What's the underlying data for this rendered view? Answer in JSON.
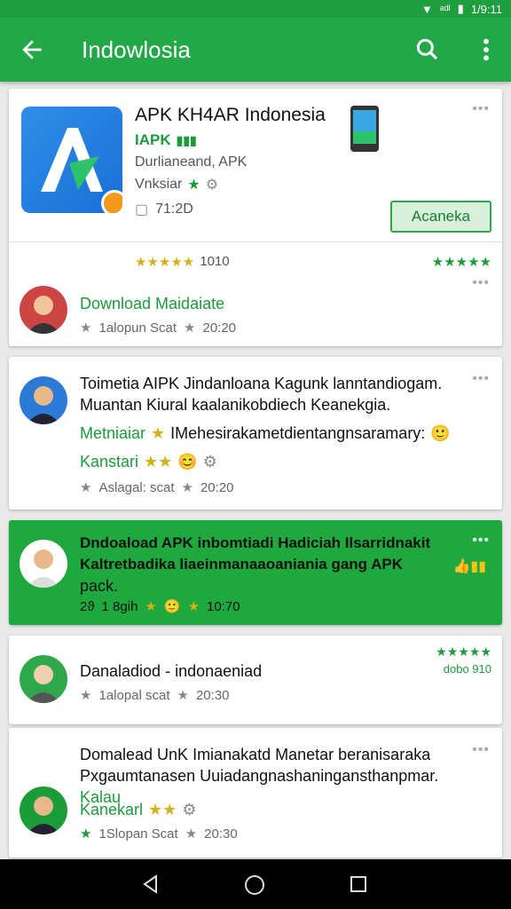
{
  "status_bar": {
    "time": "1/9:11",
    "signal_text": "ᵃᵈˡ"
  },
  "app_bar": {
    "title": "Indowlosia"
  },
  "app_card": {
    "name": "APK KH4AR  Indonesia",
    "sub_label": "IAPK",
    "description": "Durlianeand, APK",
    "rating_label": "Vnksiar",
    "size": "71:2D",
    "install_label": "Acaneka",
    "stars_left": "★★★★★",
    "stars_count": "1010",
    "stars_right": "★★★★★",
    "menu": "•••"
  },
  "reviews": [
    {
      "title": "Download Maidaiate",
      "meta_left": "1alopun Scat",
      "meta_right": "20:20",
      "menu": "•••"
    },
    {
      "body": "Toimetia AIPK Jindanloana Kagunk lanntandiogam. Muantan Kiural kaalanikobdiech Keanekgia.",
      "tag": "Metniaiar",
      "tag_rest": "IMehesirakametdientangnsaramary:",
      "subtag": "Kanstari",
      "meta_left": "Aslagal: scat",
      "meta_right": "20:20",
      "menu": "•••"
    },
    {
      "body": "Dndoaload APK inbomtiadi Hadiciah Ilsarridnakit Kaltretbadika liaeinmanaaoaniania gang APK",
      "body2": "pack.",
      "meta_left": "2ϑ",
      "meta_mid": "1 8gih",
      "meta_right": "10:70",
      "menu": "•••"
    },
    {
      "title": "Danaladiod - indonaeniad",
      "meta_left": "1alopal scat",
      "meta_right": "20:30",
      "stars_right": "★★★★★",
      "date_right": "dobo 910"
    },
    {
      "body": "Domalead UnK Imianakatd Manetar beranisaraka Pxgaumtanasen Uuiadangnashaningansthanpmar.",
      "body_green": "Kalau",
      "subtag": "Kanekarl",
      "meta_left": "1Slopan Scat",
      "meta_right": "20:30",
      "menu": "•••"
    }
  ],
  "colors": {
    "accent": "#22a846",
    "status": "#1e9e3e",
    "green_card": "#1fa83e"
  }
}
